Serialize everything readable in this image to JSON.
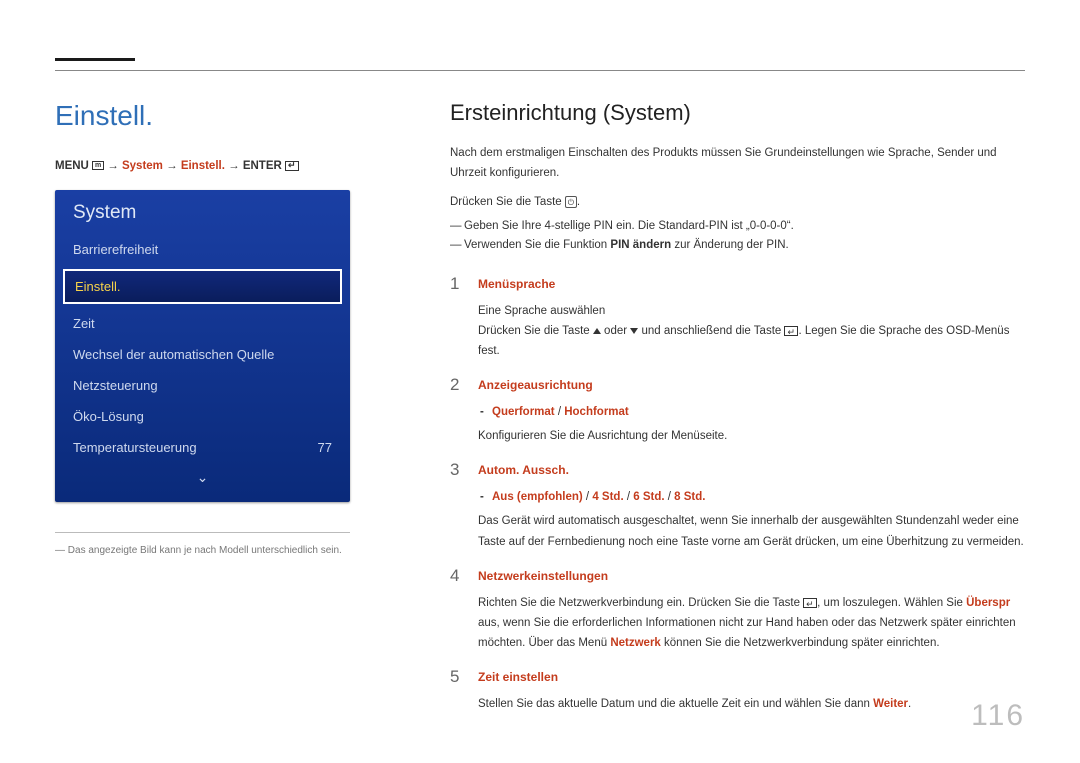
{
  "page_number": "116",
  "left": {
    "title": "Einstell.",
    "breadcrumb": {
      "menu": "MENU",
      "arrow": "→",
      "system": "System",
      "einstell": "Einstell.",
      "enter": "ENTER"
    },
    "panel_header": "System",
    "items": [
      {
        "label": "Barrierefreiheit",
        "selected": false
      },
      {
        "label": "Einstell.",
        "selected": true
      },
      {
        "label": "Zeit",
        "selected": false
      },
      {
        "label": "Wechsel der automatischen Quelle",
        "selected": false
      },
      {
        "label": "Netzsteuerung",
        "selected": false
      },
      {
        "label": "Öko-Lösung",
        "selected": false
      },
      {
        "label": "Temperatursteuerung",
        "value": "77",
        "selected": false
      }
    ],
    "footnote": "Das angezeigte Bild kann je nach Modell unterschiedlich sein."
  },
  "right": {
    "title": "Ersteinrichtung (System)",
    "intro1": "Nach dem erstmaligen Einschalten des Produkts müssen Sie Grundeinstellungen wie Sprache, Sender und Uhrzeit konfigurieren.",
    "intro2_pre": "Drücken Sie die Taste ",
    "intro2_post": ".",
    "dash1": "Geben Sie Ihre 4-stellige PIN ein. Die Standard-PIN ist „0-0-0-0“.",
    "dash2_pre": "Verwenden Sie die Funktion ",
    "dash2_bold": "PIN ändern",
    "dash2_post": " zur Änderung der PIN.",
    "steps": [
      {
        "num": "1",
        "title": "Menüsprache",
        "body1": "Eine Sprache auswählen",
        "body2_pre": "Drücken Sie die Taste ",
        "body2_mid": " oder ",
        "body2_mid2": " und anschließend die Taste ",
        "body2_post": ". Legen Sie die Sprache des OSD-Menüs fest."
      },
      {
        "num": "2",
        "title": "Anzeigeausrichtung",
        "opt1": "Querformat",
        "opt_sep": " / ",
        "opt2": "Hochformat",
        "body1": "Konfigurieren Sie die Ausrichtung der Menüseite."
      },
      {
        "num": "3",
        "title": "Autom. Aussch.",
        "opt1": "Aus (empfohlen)",
        "opt2": "4 Std.",
        "opt3": "6 Std.",
        "opt4": "8 Std.",
        "body1": "Das Gerät wird automatisch ausgeschaltet, wenn Sie innerhalb der ausgewählten Stundenzahl weder eine Taste auf der Fernbedienung noch eine Taste vorne am Gerät drücken, um eine Überhitzung zu vermeiden."
      },
      {
        "num": "4",
        "title": "Netzwerkeinstellungen",
        "body1_pre": "Richten Sie die Netzwerkverbindung ein. Drücken Sie die Taste ",
        "body1_mid": ", um loszulegen. Wählen Sie ",
        "body1_skip": "Überspr",
        "body1_mid2": " aus, wenn Sie die erforderlichen Informationen nicht zur Hand haben oder das Netzwerk später einrichten möchten. Über das Menü ",
        "body1_net": "Netzwerk",
        "body1_post": " können Sie die Netzwerkverbindung später einrichten."
      },
      {
        "num": "5",
        "title": "Zeit einstellen",
        "body1_pre": "Stellen Sie das aktuelle Datum und die aktuelle Zeit ein und wählen Sie dann ",
        "body1_bold": "Weiter",
        "body1_post": "."
      }
    ]
  }
}
